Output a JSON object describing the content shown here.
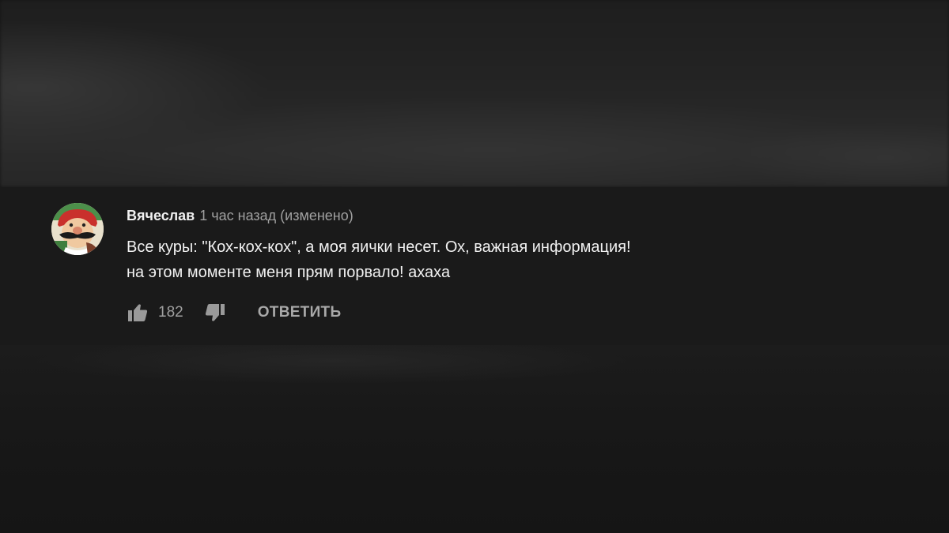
{
  "comment": {
    "author": "Вячеслав",
    "time": "1 час назад (изменено)",
    "text_line_1": "Все куры: \"Кох-кох-кох\", а моя яички несет. Ох, важная информация!",
    "text_line_2": "на этом моменте меня прям порвало! ахаха",
    "like_count": "182",
    "reply_label": "ОТВЕТИТЬ",
    "avatar_icon": "cartoon-character-avatar",
    "like_icon": "thumbs-up-icon",
    "dislike_icon": "thumbs-down-icon"
  },
  "colors": {
    "background": "#141414",
    "comment_background": "#1a1a1a",
    "primary_text": "#f1f1f1",
    "secondary_text": "#a0a0a0"
  }
}
